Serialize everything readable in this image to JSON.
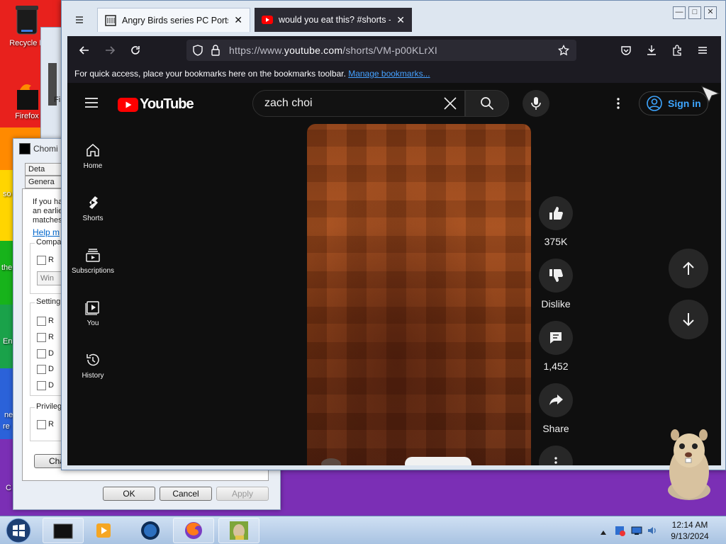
{
  "desktop": {
    "icons": [
      {
        "label": "Recycle B"
      },
      {
        "label": "Firefox"
      }
    ],
    "fragments": [
      "so",
      "the",
      "En",
      "ne",
      "re",
      "C",
      "Fi"
    ]
  },
  "bg_dialog": {
    "title": "Chomi",
    "tabs": [
      "Deta",
      "Genera"
    ],
    "body_text": [
      "If you ha",
      "an earlie",
      "matches"
    ],
    "help_link": "Help m",
    "groups": {
      "compat": "Compa",
      "settings": "Setting",
      "privilege": "Privileg"
    },
    "checkbox_labels": [
      "R",
      "R",
      "R",
      "D",
      "D",
      "D",
      "R"
    ],
    "combo_value": "Win",
    "change_button": "Cha",
    "ok": "OK",
    "cancel": "Cancel",
    "apply": "Apply"
  },
  "browser": {
    "tabs": [
      {
        "title": "Angry Birds series PC Ports : Ro",
        "close": "✕"
      },
      {
        "title": "would you eat this? #shorts - Y",
        "close": "✕"
      }
    ],
    "url": {
      "prefix": "https://www.",
      "host": "youtube.com",
      "path": "/shorts/VM-p00KLrXI"
    },
    "bookmarks_text": "For quick access, place your bookmarks here on the bookmarks toolbar.",
    "bookmarks_link": "Manage bookmarks..."
  },
  "youtube": {
    "logo_text": "YouTube",
    "search_value": "zach choi",
    "signin": "Sign in",
    "sidebar": [
      {
        "label": "Home",
        "icon": "home-icon"
      },
      {
        "label": "Shorts",
        "icon": "shorts-icon"
      },
      {
        "label": "Subscriptions",
        "icon": "subscriptions-icon"
      },
      {
        "label": "You",
        "icon": "you-icon"
      },
      {
        "label": "History",
        "icon": "history-icon"
      }
    ],
    "actions": {
      "like_count": "375K",
      "dislike_label": "Dislike",
      "comment_count": "1,452",
      "share_label": "Share"
    }
  },
  "taskbar": {
    "time": "12:14 AM",
    "date": "9/13/2024"
  },
  "colors": {
    "youtube_red": "#ff0000",
    "link_blue": "#3ea6ff",
    "firefox_bg": "#1c1b22"
  }
}
